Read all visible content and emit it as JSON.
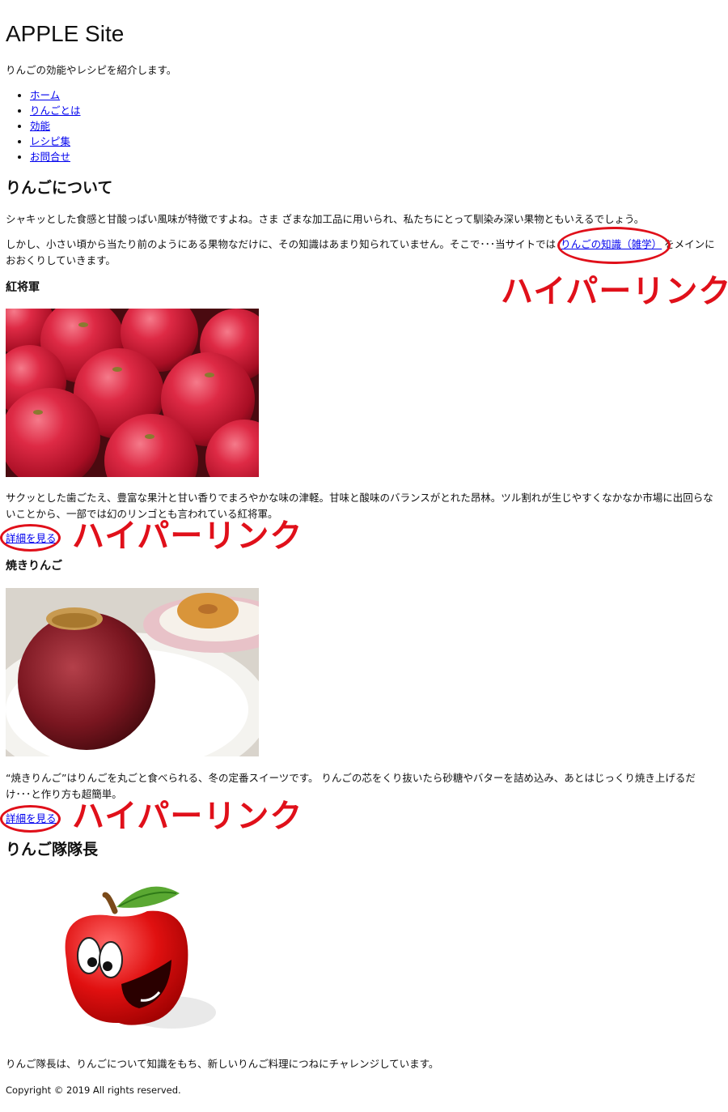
{
  "site": {
    "title": "APPLE Site",
    "tagline": "りんごの効能やレシピを紹介します。"
  },
  "nav": {
    "items": [
      {
        "label": "ホーム"
      },
      {
        "label": "りんごとは"
      },
      {
        "label": "効能"
      },
      {
        "label": "レシピ集"
      },
      {
        "label": "お問合せ"
      }
    ]
  },
  "about": {
    "heading": "りんごについて",
    "p1": "シャキッとした食感と甘酸っぱい風味が特徴ですよね。さま ざまな加工品に用いられ、私たちにとって馴染み深い果物ともいえるでしょう。",
    "p2_before": "しかし、小さい頃から当たり前のようにある果物なだけに、その知識はあまり知られていません。そこで･･･当サイトでは",
    "p2_link": "りんごの知識（雑学）",
    "p2_after": "をメインにおおくりしていきます。"
  },
  "kousyougun": {
    "heading": "紅将軍",
    "description": "サクッとした歯ごたえ、豊富な果汁と甘い香りでまろやかな味の津軽。甘味と酸味のバランスがとれた昂林。ツル割れが生じやすくなかなか市場に出回らないことから、一部では幻のリンゴとも言われている紅将軍。",
    "detail_link": "詳細を見る"
  },
  "yakiringo": {
    "heading": "焼きりんご",
    "description": "“焼きりんご”はりんごを丸ごと食べられる、冬の定番スイーツです。 りんごの芯をくり抜いたら砂糖やバターを詰め込み、あとはじっくり焼き上げるだけ･･･と作り方も超簡単。",
    "detail_link": "詳細を見る"
  },
  "captain": {
    "heading": "りんご隊隊長",
    "description": "りんご隊長は、りんごについて知識をもち、新しいりんご料理につねにチャレンジしています。"
  },
  "footer": {
    "copyright": "Copyright © 2019 All rights reserved."
  },
  "annotations": {
    "label": "ハイパーリンク",
    "color": "#e0101a"
  }
}
